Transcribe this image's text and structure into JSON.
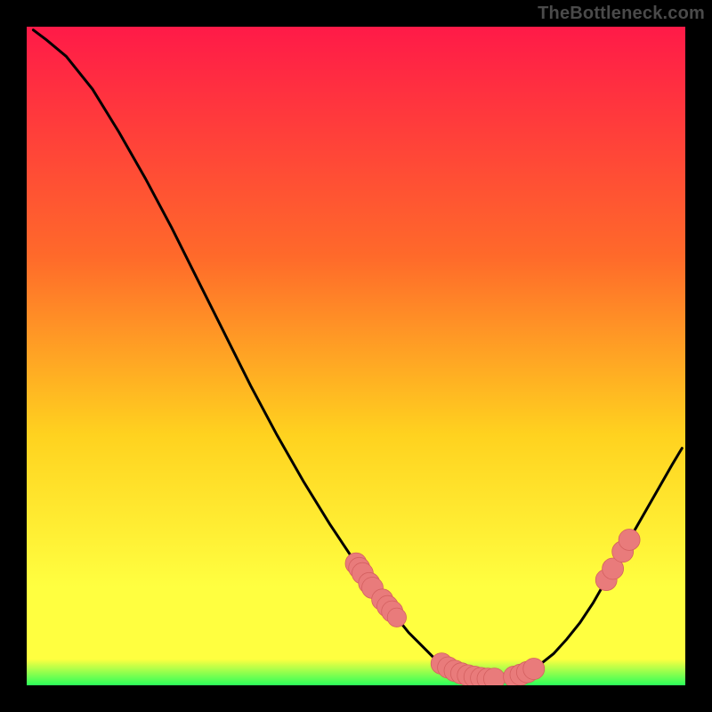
{
  "watermark": "TheBottleneck.com",
  "colors": {
    "bg": "#000000",
    "grad_top": "#ff1a48",
    "grad_mid1": "#ff6a2a",
    "grad_mid2": "#ffd21f",
    "grad_mid3": "#ffff40",
    "grad_bottom": "#2bff5a",
    "curve": "#000000",
    "marker_fill": "#e97b7b",
    "marker_stroke": "#d46060"
  },
  "chart_data": {
    "type": "line",
    "title": "",
    "xlabel": "",
    "ylabel": "",
    "xlim": [
      0,
      100
    ],
    "ylim": [
      0,
      100
    ],
    "curve": [
      {
        "x": 1.0,
        "y": 99.5
      },
      {
        "x": 3.0,
        "y": 98.0
      },
      {
        "x": 6.0,
        "y": 95.5
      },
      {
        "x": 10.0,
        "y": 90.5
      },
      {
        "x": 14.0,
        "y": 84.0
      },
      {
        "x": 18.0,
        "y": 77.0
      },
      {
        "x": 22.0,
        "y": 69.5
      },
      {
        "x": 26.0,
        "y": 61.5
      },
      {
        "x": 30.0,
        "y": 53.5
      },
      {
        "x": 34.0,
        "y": 45.5
      },
      {
        "x": 38.0,
        "y": 38.0
      },
      {
        "x": 42.0,
        "y": 31.0
      },
      {
        "x": 46.0,
        "y": 24.5
      },
      {
        "x": 48.0,
        "y": 21.5
      },
      {
        "x": 50.0,
        "y": 18.5
      },
      {
        "x": 52.0,
        "y": 15.5
      },
      {
        "x": 54.0,
        "y": 13.0
      },
      {
        "x": 56.0,
        "y": 10.5
      },
      {
        "x": 58.0,
        "y": 8.0
      },
      {
        "x": 60.0,
        "y": 6.0
      },
      {
        "x": 62.0,
        "y": 4.0
      },
      {
        "x": 64.0,
        "y": 2.7
      },
      {
        "x": 66.0,
        "y": 1.8
      },
      {
        "x": 68.0,
        "y": 1.3
      },
      {
        "x": 70.0,
        "y": 1.0
      },
      {
        "x": 72.0,
        "y": 1.0
      },
      {
        "x": 74.0,
        "y": 1.3
      },
      {
        "x": 76.0,
        "y": 2.0
      },
      {
        "x": 78.0,
        "y": 3.2
      },
      {
        "x": 80.0,
        "y": 4.8
      },
      {
        "x": 82.0,
        "y": 7.0
      },
      {
        "x": 84.0,
        "y": 9.5
      },
      {
        "x": 86.0,
        "y": 12.5
      },
      {
        "x": 88.0,
        "y": 16.0
      },
      {
        "x": 90.0,
        "y": 19.5
      },
      {
        "x": 92.0,
        "y": 23.0
      },
      {
        "x": 94.0,
        "y": 26.5
      },
      {
        "x": 96.0,
        "y": 30.0
      },
      {
        "x": 98.0,
        "y": 33.5
      },
      {
        "x": 99.5,
        "y": 36.0
      }
    ],
    "markers": [
      {
        "x": 50.0,
        "y": 18.5,
        "r": 1.2
      },
      {
        "x": 50.5,
        "y": 17.8,
        "r": 1.2
      },
      {
        "x": 51.0,
        "y": 17.0,
        "r": 1.2
      },
      {
        "x": 52.0,
        "y": 15.5,
        "r": 1.2
      },
      {
        "x": 52.5,
        "y": 14.8,
        "r": 1.2
      },
      {
        "x": 54.0,
        "y": 13.0,
        "r": 1.2
      },
      {
        "x": 54.8,
        "y": 12.0,
        "r": 1.2
      },
      {
        "x": 55.5,
        "y": 11.2,
        "r": 1.2
      },
      {
        "x": 56.2,
        "y": 10.3,
        "r": 1.0
      },
      {
        "x": 63.0,
        "y": 3.3,
        "r": 1.2
      },
      {
        "x": 64.0,
        "y": 2.7,
        "r": 1.2
      },
      {
        "x": 65.0,
        "y": 2.2,
        "r": 1.2
      },
      {
        "x": 66.0,
        "y": 1.8,
        "r": 1.2
      },
      {
        "x": 67.0,
        "y": 1.5,
        "r": 1.2
      },
      {
        "x": 68.0,
        "y": 1.3,
        "r": 1.2
      },
      {
        "x": 69.0,
        "y": 1.1,
        "r": 1.2
      },
      {
        "x": 70.0,
        "y": 1.0,
        "r": 1.2
      },
      {
        "x": 71.0,
        "y": 1.0,
        "r": 1.2
      },
      {
        "x": 74.0,
        "y": 1.3,
        "r": 1.2
      },
      {
        "x": 75.0,
        "y": 1.6,
        "r": 1.2
      },
      {
        "x": 76.0,
        "y": 2.0,
        "r": 1.2
      },
      {
        "x": 77.0,
        "y": 2.5,
        "r": 1.2
      },
      {
        "x": 88.0,
        "y": 16.0,
        "r": 1.2
      },
      {
        "x": 89.0,
        "y": 17.7,
        "r": 1.2
      },
      {
        "x": 90.5,
        "y": 20.3,
        "r": 1.2
      },
      {
        "x": 91.5,
        "y": 22.1,
        "r": 1.2
      }
    ]
  }
}
